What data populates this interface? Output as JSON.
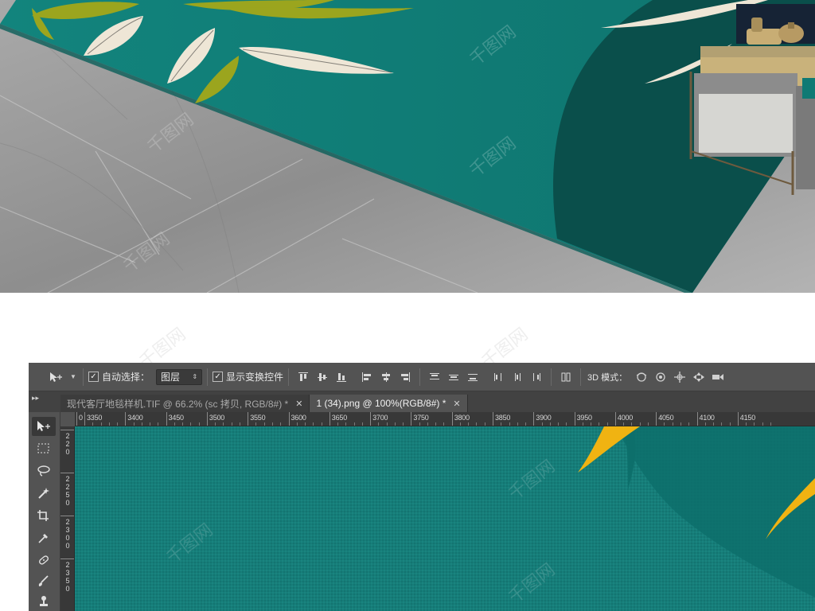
{
  "photoshop": {
    "options_bar": {
      "move_tool_icon": "move-tool-icon",
      "auto_select_checked": true,
      "auto_select_label": "自动选择：",
      "auto_select_target": "图层",
      "show_transform_checked": true,
      "show_transform_label": "显示变换控件",
      "mode_3d_label": "3D 模式："
    },
    "tabs": [
      {
        "label": "现代客厅地毯样机.TIF @ 66.2% (sc 拷贝, RGB/8#) *",
        "active": false
      },
      {
        "label": "1 (34).png @ 100%(RGB/8#) *",
        "active": true
      }
    ],
    "ruler": {
      "top_labels": [
        "0",
        "3350",
        "3400",
        "3450",
        "3500",
        "3550",
        "3600",
        "3650",
        "3700",
        "3750",
        "3800",
        "3850",
        "3900",
        "3950",
        "4000",
        "4050",
        "4100",
        "4150"
      ],
      "left_labels": [
        "220",
        "2250",
        "2300",
        "2350"
      ]
    },
    "tools": [
      "move-tool",
      "marquee-tool",
      "lasso-tool",
      "magic-wand-tool",
      "crop-tool",
      "eyedropper-tool",
      "healing-brush-tool",
      "brush-tool",
      "clone-stamp-tool"
    ]
  },
  "colors": {
    "rug_teal": "#0f7a74",
    "rug_dark": "#0a4f4b",
    "leaf_gold": "#9ba51e",
    "leaf_cream": "#eee6d6",
    "canvas_teal": "#167d79",
    "canvas_shape": "#0d6f6b",
    "stroke_yellow": "#f0b312",
    "ps_panel": "#535353"
  },
  "watermark_text": "千图网"
}
